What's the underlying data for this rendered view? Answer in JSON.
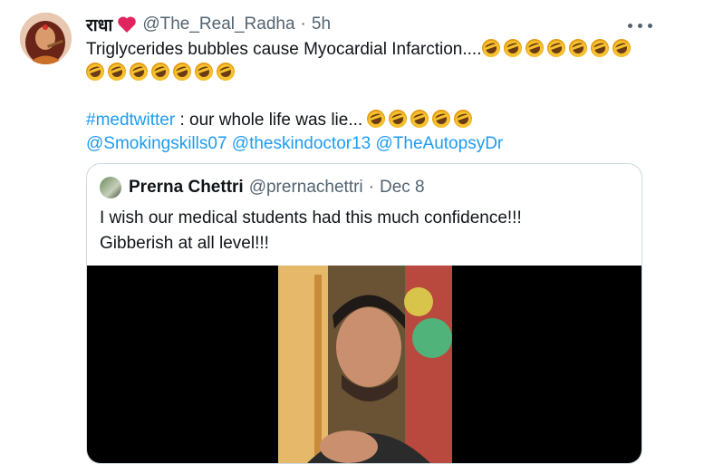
{
  "tweet": {
    "display_name": "राधा",
    "handle": "@The_Real_Radha",
    "separator": "·",
    "time": "5h",
    "line1": "Triglycerides bubbles cause Myocardial Infarction....",
    "line1_emoji_count": 7,
    "line2_emoji_count": 7,
    "hashtag": "#medtwitter",
    "hashtag_text": " : our whole life was lie...",
    "hashtag_emoji_count": 5,
    "mentions": [
      "@Smokingskills07",
      "@theskindoctor13",
      "@TheAutopsyDr"
    ],
    "icons": {
      "heart": "red-heart-icon",
      "emoji": "rolling-on-floor-laughing-emoji",
      "more": "more-options-icon"
    }
  },
  "quoted": {
    "display_name": "Prerna Chettri",
    "handle": "@prernachettri",
    "separator": "·",
    "date": "Dec 8",
    "line1": "I wish our medical students had this much confidence!!!",
    "line2": "Gibberish at all level!!!"
  },
  "colors": {
    "link": "#1d9bf0",
    "secondary": "#536471",
    "text": "#0f1419",
    "heart": "#e0245e"
  }
}
